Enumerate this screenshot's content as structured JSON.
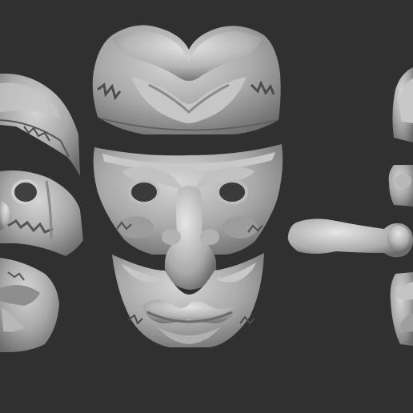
{
  "scene": {
    "background_color": "#303030",
    "clay_light": "#d4d4d4",
    "clay_mid": "#a9a9a9",
    "clay_dark": "#6e6e6e",
    "views": [
      {
        "label": "left-side-view",
        "parts": [
          "forehead-piece",
          "eye-piece",
          "jaw-piece"
        ]
      },
      {
        "label": "front-view",
        "parts": [
          "forehead-piece",
          "face-piece-with-nose",
          "jaw-piece"
        ]
      },
      {
        "label": "right-side-view",
        "parts": [
          "forehead-piece",
          "eye-piece",
          "nose-piece",
          "jaw-piece"
        ]
      }
    ]
  }
}
